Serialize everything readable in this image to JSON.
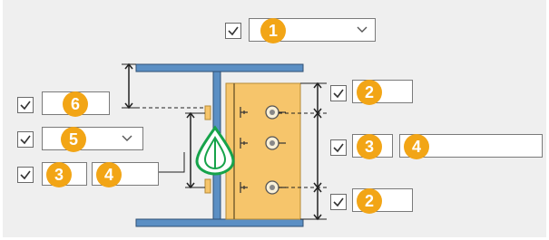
{
  "callouts": {
    "top_dropdown": "1",
    "right_top": "2",
    "right_mid_a": "3",
    "right_mid_b": "4",
    "right_bottom": "2",
    "left_top": "6",
    "left_dropdown": "5",
    "left_bottom_a": "3",
    "left_bottom_b": "4"
  },
  "checkboxes": {
    "top_dropdown": true,
    "right_top": true,
    "right_mid": true,
    "right_bottom": true,
    "left_top": true,
    "left_dropdown": true,
    "left_bottom": true
  },
  "colors": {
    "beam": "#5b8fc4",
    "plate": "#f6c56b",
    "badge": "#f2a516",
    "symbol": "#16a34a"
  },
  "icons": [
    "checkbox-checked-icon",
    "chevron-down-icon",
    "bolt-icon",
    "weld-drop-icon",
    "dimension-arrow-icon"
  ]
}
